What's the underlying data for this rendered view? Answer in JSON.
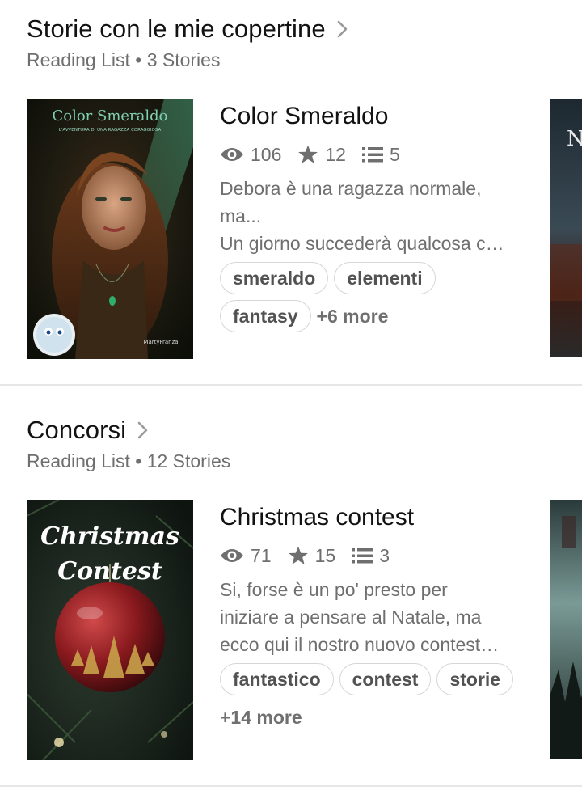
{
  "lists": [
    {
      "title": "Storie con le mie copertine",
      "meta": "Reading List • 3 Stories",
      "story": {
        "title": "Color Smeraldo",
        "reads": "106",
        "votes": "12",
        "parts": "5",
        "description_lines": [
          "Debora è una ragazza normale,",
          "ma...",
          "Un giorno succederà qualcosa c…"
        ],
        "tags": [
          "smeraldo",
          "elementi",
          "fantasy"
        ],
        "more": "+6 more",
        "cover": {
          "title": "Color Smeraldo",
          "subtitle": "L'AVVENTURA DI UNA RAGAZZA CORAGGIOSA",
          "author": "MartyFranza"
        }
      },
      "peek_cover_text": "N"
    },
    {
      "title": "Concorsi",
      "meta": "Reading List • 12 Stories",
      "story": {
        "title": "Christmas contest",
        "reads": "71",
        "votes": "15",
        "parts": "3",
        "description_lines": [
          "Si, forse è un po' presto per",
          "iniziare a pensare al Natale, ma",
          "ecco qui il nostro nuovo contest…"
        ],
        "tags": [
          "fantastico",
          "contest",
          "storie"
        ],
        "more": "+14 more",
        "cover": {
          "line1": "Christmas",
          "line2": "Contest"
        }
      }
    }
  ],
  "colors": {
    "text_primary": "#121212",
    "text_secondary": "#6f6f6f",
    "tag_border": "#d6d6d6",
    "divider": "#e6e6e6"
  }
}
